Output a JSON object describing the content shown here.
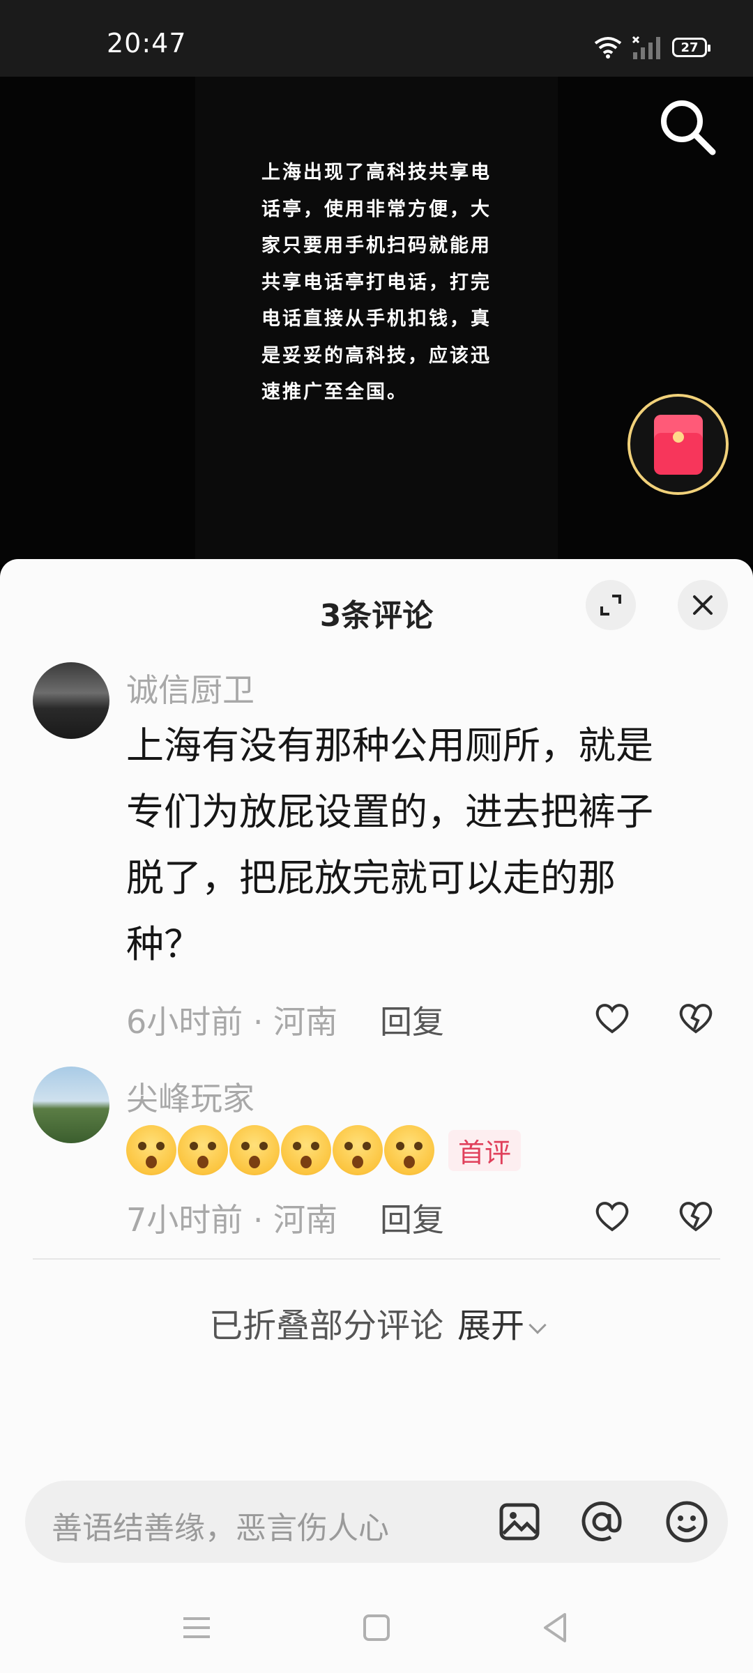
{
  "status_bar": {
    "time": "20:47",
    "battery": "27",
    "icons": [
      "wifi-icon",
      "signal-icon",
      "battery-icon"
    ]
  },
  "video": {
    "caption": "上海出现了高科技共享电话亭，使用非常方便，大家只要用手机扫码就能用共享电话亭打电话，打完电话直接从手机扣钱，真是妥妥的高科技，应该迅速推广至全国。",
    "caption_lines": [
      "上海出现了高科技共享电",
      "话亭，使用非常方便，大",
      "家只要用手机扫码就能用",
      "共享电话亭打电话，打完",
      "电话直接从手机扣钱，真",
      "是妥妥的高科技，应该迅",
      "速推广至全国。"
    ]
  },
  "comments_sheet": {
    "title": "3条评论",
    "comments": [
      {
        "username": "诚信厨卫",
        "lines": [
          "上海有没有那种公用厕所，就是",
          "专们为放屁设置的，进去把裤子",
          "脱了，把屁放完就可以走的那",
          "种？"
        ],
        "time": "6小时前 · 河南",
        "reply": "回复"
      },
      {
        "username": "尖峰玩家",
        "emoji_count": 6,
        "badge": "首评",
        "time": "7小时前 · 河南",
        "reply": "回复"
      }
    ],
    "folded_text": "已折叠部分评论",
    "expand_label": "展开"
  },
  "input": {
    "placeholder": "善语结善缘，恶言伤人心"
  },
  "colors": {
    "accent_red": "#f7365b",
    "ring_gold": "#f1d17a",
    "badge_text": "#e0405b"
  }
}
